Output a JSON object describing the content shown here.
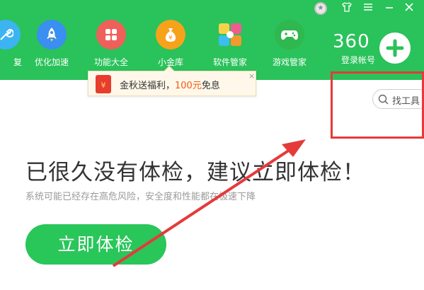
{
  "topbar": {
    "bg_color": "#2ac25a",
    "window_buttons": [
      "shirt-icon",
      "menu-icon",
      "minimize-icon",
      "close-icon"
    ],
    "medal_icon": "medal-icon"
  },
  "nav": {
    "items": [
      {
        "label": "复",
        "icon": "repair-icon",
        "color": "#3db4f2"
      },
      {
        "label": "优化加速",
        "icon": "rocket-icon",
        "color": "#3a8ff0"
      },
      {
        "label": "功能大全",
        "icon": "grid-icon",
        "color": "#f0605a"
      },
      {
        "label": "小金库",
        "icon": "moneybag-icon",
        "color": "#f7a21b"
      },
      {
        "label": "软件管家",
        "icon": "puzzle-icon",
        "color": "#f5d24a"
      },
      {
        "label": "游戏管家",
        "icon": "gamepad-icon",
        "color": "#2eb84f"
      }
    ],
    "active_index": 3
  },
  "account": {
    "brand": "360",
    "login_label": "登录帐号",
    "add_icon": "plus-icon"
  },
  "promo": {
    "text_before": "金秋送福利，",
    "amount": "100元",
    "text_after": "免息",
    "close": "×",
    "icon_glyph": "¥"
  },
  "tool_search": {
    "label": "找工具"
  },
  "main": {
    "headline": "已很久没有体检，建议立即体检！",
    "subtext": "系统可能已经存在高危风险，安全度和性能都在极速下降",
    "check_button": "立即体检"
  },
  "annotation": {
    "color": "#e53a3a"
  }
}
